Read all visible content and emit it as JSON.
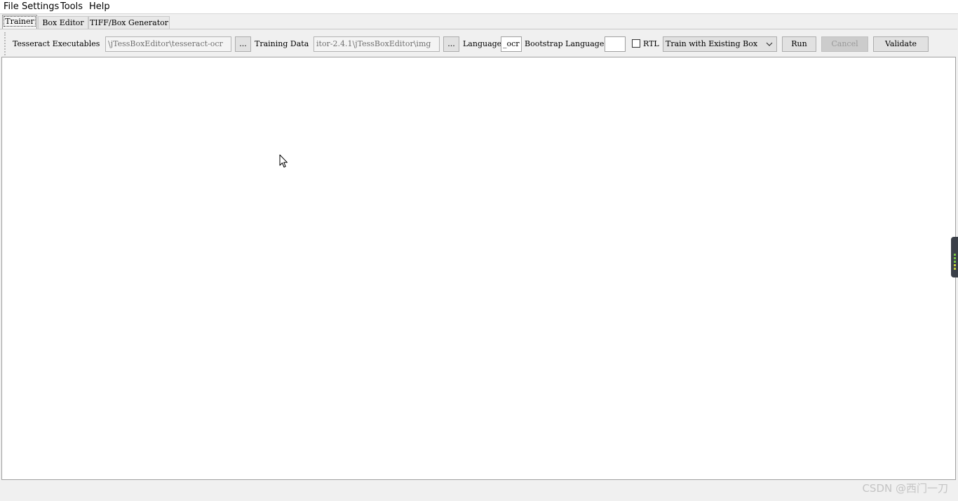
{
  "menu": {
    "items": [
      "File",
      "Settings",
      "Tools",
      "Help"
    ]
  },
  "tabs": {
    "items": [
      "Trainer",
      "Box Editor",
      "TIFF/Box Generator"
    ],
    "active_index": 0
  },
  "toolbar": {
    "tess_exec_label": "Tesseract Executables",
    "tess_exec_value": "\\jTessBoxEditor\\tesseract-ocr",
    "browse_label": "...",
    "training_data_label": "Training Data",
    "training_data_value": "itor-2.4.1\\jTessBoxEditor\\img",
    "language_label": "Language",
    "language_value": "_ocr",
    "bootstrap_label": "Bootstrap Language",
    "bootstrap_value": "",
    "rtl_label": "RTL",
    "rtl_checked": false,
    "mode_selected": "Train with Existing Box",
    "run_label": "Run",
    "cancel_label": "Cancel",
    "validate_label": "Validate"
  },
  "content": {
    "log_text": ""
  },
  "watermark": "CSDN @西门一刀",
  "colors": {
    "window_bg": "#f0f0f0",
    "content_bg": "#ffffff",
    "disabled_button": "#cccccc"
  }
}
